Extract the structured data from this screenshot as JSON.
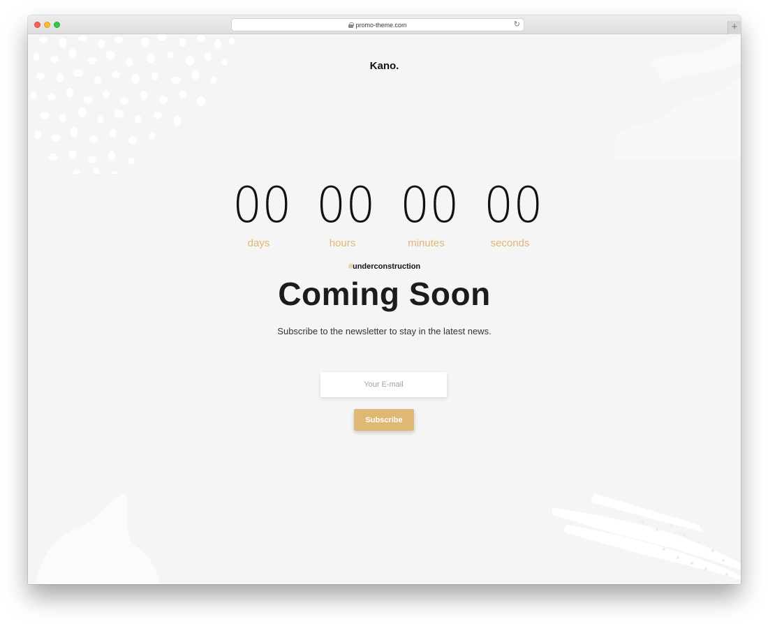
{
  "browser": {
    "url": "promo-theme.com",
    "icons": {
      "secure": "lock-icon",
      "reload": "reload-icon",
      "new_tab": "plus-icon"
    }
  },
  "site": {
    "logo": "Kano."
  },
  "countdown": {
    "days": {
      "value": "00",
      "label": "days"
    },
    "hours": {
      "value": "00",
      "label": "hours"
    },
    "minutes": {
      "value": "00",
      "label": "minutes"
    },
    "seconds": {
      "value": "00",
      "label": "seconds"
    }
  },
  "hero": {
    "tag_hash": "#",
    "tag_text": "underconstruction",
    "title": "Coming Soon",
    "subtitle": "Subscribe to the newsletter to stay in the latest news."
  },
  "newsletter": {
    "email_placeholder": "Your E-mail",
    "email_value": "",
    "subscribe_label": "Subscribe"
  },
  "colors": {
    "accent": "#dfb874",
    "background": "#f5f5f5",
    "text": "#1c1c1c"
  }
}
